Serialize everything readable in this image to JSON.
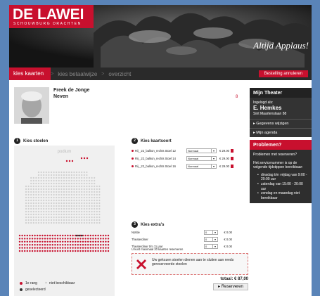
{
  "header": {
    "logo_title": "DE LAWEI",
    "logo_subtitle": "SCHOUWBURG DRACHTEN",
    "slogan": "Altijd Applaus!",
    "steps": [
      "kies kaarten",
      "kies betaalwijze",
      "overzicht"
    ],
    "cancel_label": "Bestelling annuleren"
  },
  "performer": {
    "name": "Freek de Jonge",
    "show": "Neven",
    "marker": "8"
  },
  "sections": {
    "seats": "Kies stoelen",
    "ticket_type": "Kies kaartsoort",
    "extras": "Kies extra's"
  },
  "seatmap": {
    "stage_label": "podium"
  },
  "legend": {
    "row_label": "1e rang",
    "unavailable_label": "niet beschikbaar",
    "selected_label": "geselecteerd"
  },
  "tickets": [
    {
      "label": "Rij _22_balkon_rechts Stoel 12",
      "type": "Normaal",
      "price": "€ 29.00"
    },
    {
      "label": "Rij _22_balkon_rechts Stoel 14",
      "type": "Normaal",
      "price": "€ 29.00"
    },
    {
      "label": "Rij _22_balkon_rechts Stoel 16",
      "type": "Normaal",
      "price": "€ 29.00"
    }
  ],
  "extras": [
    {
      "label": "Notitie",
      "qty": "0",
      "price": "€ 0.00"
    },
    {
      "label": "Theaterdiner",
      "qty": "0",
      "price": "€ 0.00"
    },
    {
      "label": "Theaterdiner t/m 11 jaar",
      "qty": "0",
      "price": "€ 0.00"
    }
  ],
  "note": "U kunt maximaal 20 kaarten reserveren",
  "warning": "Uw gekozen stoelen dienen aan te sluiten aan reeds gereserveerde stoelen",
  "total": "totaal:  € 87,00",
  "reserve_label": "Reserveren",
  "sidebar": {
    "title": "Mijn Theater",
    "logged_in_label": "Ingelogd als:",
    "user_name": "E. Hemkes",
    "user_address": "Sint Maartenslaan 88",
    "links": [
      "Gegevens wijzigen",
      "Mijn agenda"
    ],
    "problems_title": "Problemen?",
    "problems_intro": "Problemen met reserveren?",
    "problems_text": "Het servicenummer is op de volgende tijdstippen bereikbaar:",
    "hours": [
      "dinsdag t/m vrijdag van 9:00 - 20:00 uur",
      "zaterdag van 15:00 - 20:00 uur",
      "zondag en maandag niet bereikbaar"
    ]
  },
  "colors": {
    "brand_red": "#c8102e",
    "sidebar_dark": "#333333",
    "page_blue": "#5a84b8"
  }
}
